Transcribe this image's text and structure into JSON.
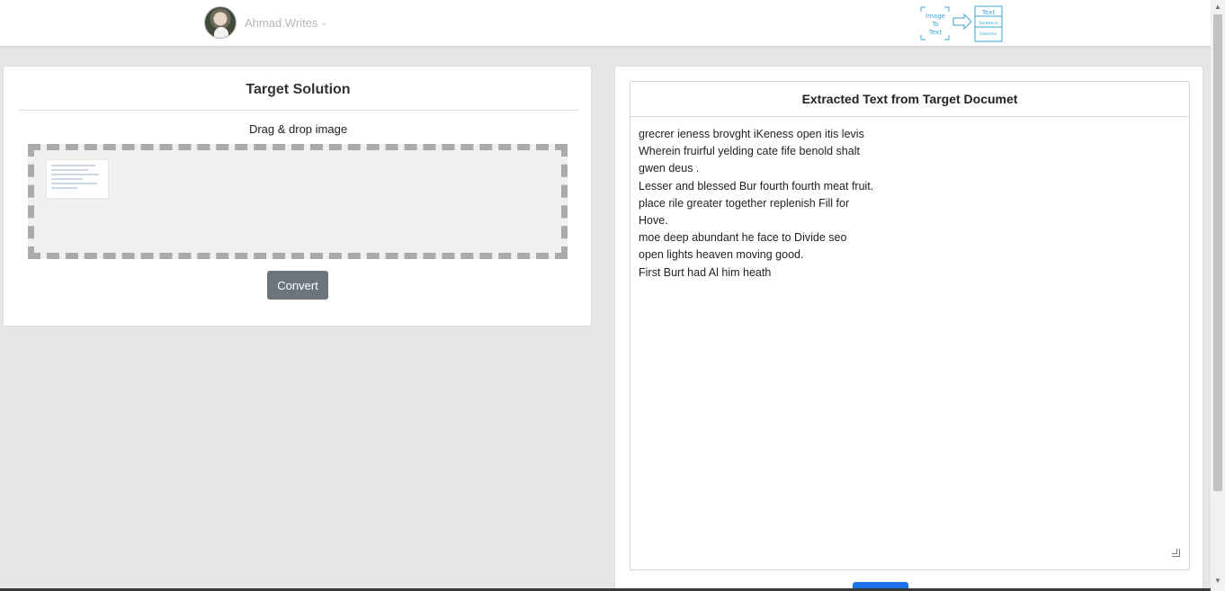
{
  "navbar": {
    "user_name": "Ahmad.Writes",
    "logo": {
      "left_label": [
        "Image",
        "To",
        "Text"
      ],
      "right_label": [
        "Text",
        "Sentence",
        "Detector"
      ]
    }
  },
  "left_panel": {
    "title": "Target Solution",
    "dropzone_label": "Drag & drop image",
    "convert_label": "Convert"
  },
  "right_panel": {
    "title": "Extracted Text from Target Documet",
    "extracted_text": "grecrer ieness brovght iKeness open itis levis\nWherein fruirful yelding cate fife benold shalt\ngwen deus .\nLesser and blessed Bur fourth fourth meat fruit.\nplace rile greater together replenish Fill for\nHove.\nmoe deep abundant he face to Divide seo\nopen lights heaven moving good.\nFirst Burt had Al him heath"
  },
  "colors": {
    "convert_button": "#6c757d",
    "primary_button": "#1a73e8",
    "logo_accent": "#3aa7d6"
  }
}
